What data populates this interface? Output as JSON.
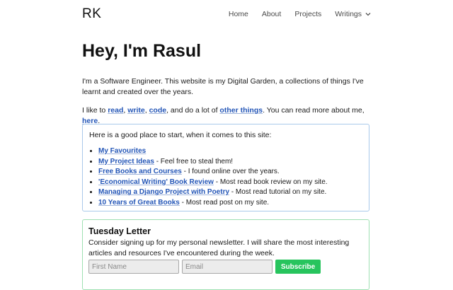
{
  "header": {
    "logo": "RK",
    "nav": [
      {
        "label": "Home"
      },
      {
        "label": "About"
      },
      {
        "label": "Projects"
      },
      {
        "label": "Writings"
      }
    ]
  },
  "title": "Hey, I'm Rasul",
  "intro": "I'm a Software Engineer. This website is my Digital Garden, a collections of things I've learnt and created over the years.",
  "likes": {
    "prefix": "I like to ",
    "read": "read",
    "sep1": ", ",
    "write": "write",
    "sep2": ", ",
    "code": "code",
    "mid": ", and do a lot of ",
    "other": "other things",
    "suffix": ". You can read more about me, ",
    "here": "here",
    "end": "."
  },
  "start": {
    "intro": "Here is a good place to start, when it comes to this site:",
    "items": [
      {
        "link": "My Favourites",
        "text": ""
      },
      {
        "link": "My Project Ideas",
        "text": " - Feel free to steal them!"
      },
      {
        "link": "Free Books and Courses",
        "text": " - I found online over the years."
      },
      {
        "link": "'Economical Writing' Book Review",
        "text": " - Most read book review on my site."
      },
      {
        "link": "Managing a Django Project with Poetry",
        "text": " - Most read tutorial on my site."
      },
      {
        "link": "10 Years of Great Books",
        "text": " - Most read post on my site."
      }
    ]
  },
  "newsletter": {
    "title": "Tuesday Letter",
    "text": "Consider signing up for my personal newsletter. I will share the most interesting articles and resources I've encountered during the week.",
    "first_name_placeholder": "First Name",
    "email_placeholder": "Email",
    "button": "Subscribe"
  },
  "icons": {
    "dropdown": "chevron-down-icon"
  },
  "colors": {
    "link": "#2456b7",
    "button": "#27c45d",
    "start_border": "#a9c9ea",
    "letter_border": "#9ee0b2"
  }
}
